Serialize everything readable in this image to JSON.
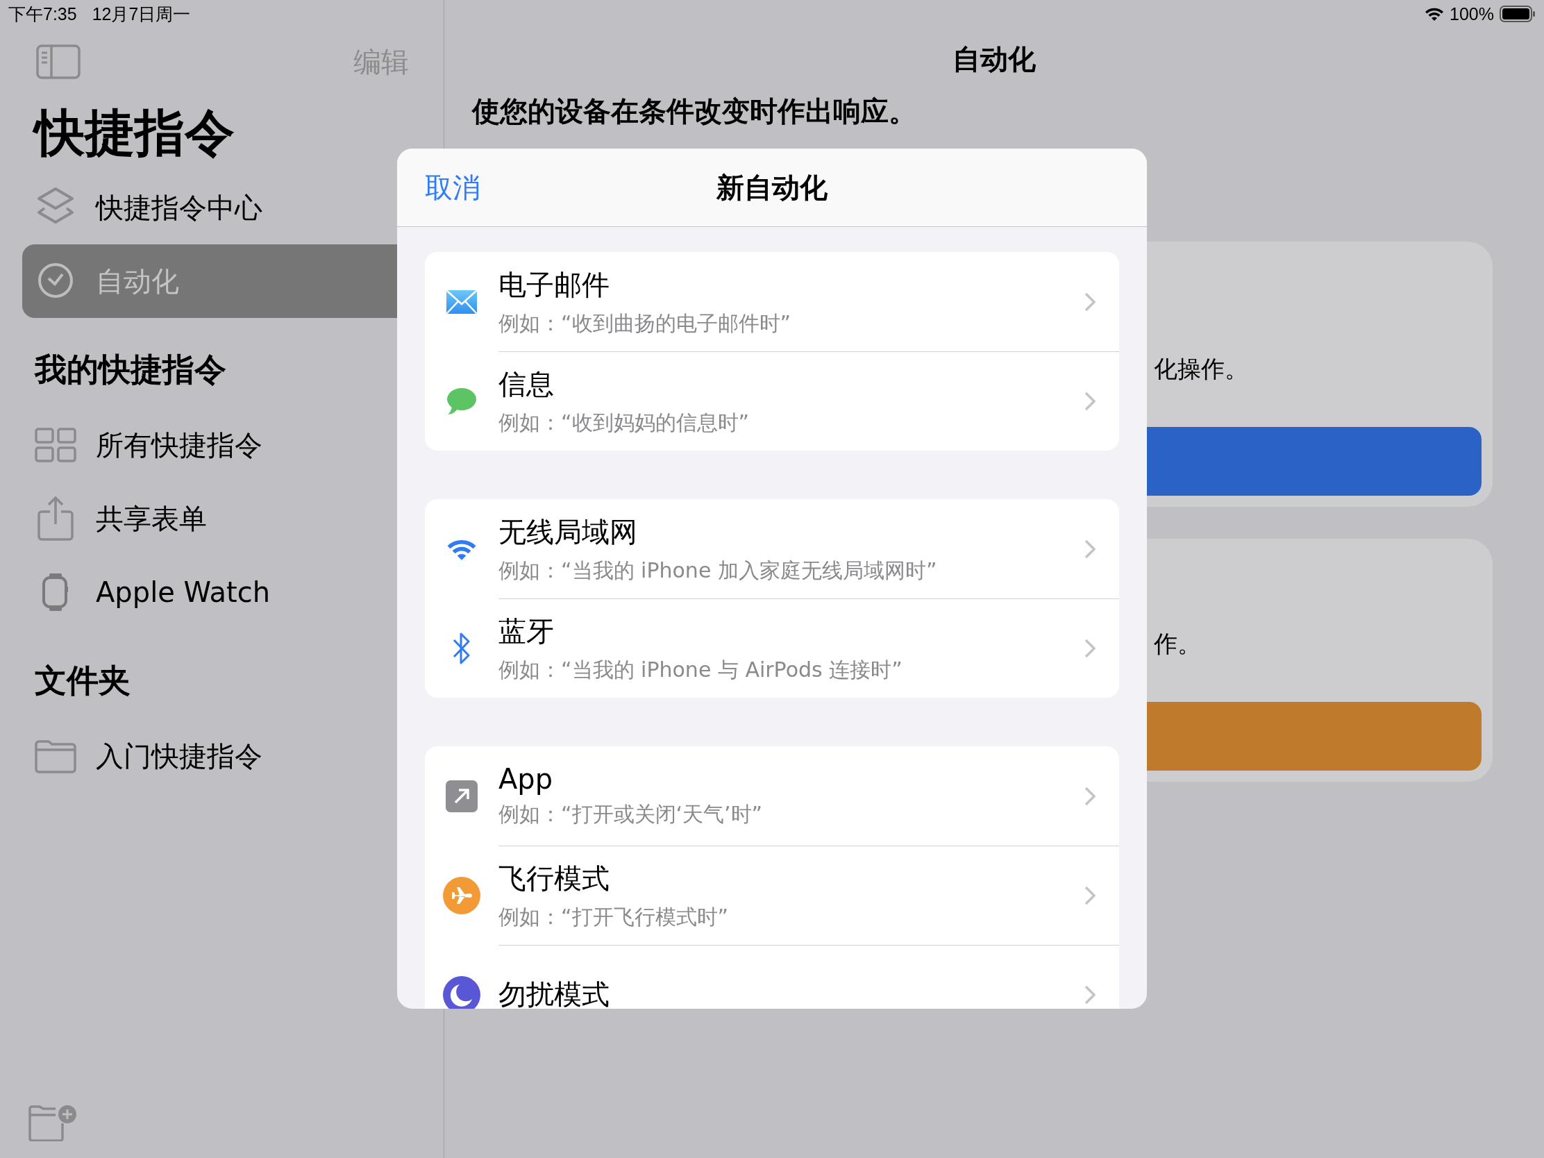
{
  "status_bar": {
    "time": "下午7:35",
    "date": "12月7日周一",
    "battery": "100%"
  },
  "sidebar": {
    "edit": "编辑",
    "title": "快捷指令",
    "items": [
      {
        "label": "快捷指令中心",
        "kind": "gallery",
        "selected": false
      },
      {
        "label": "自动化",
        "kind": "automation",
        "selected": true
      }
    ],
    "sections": [
      {
        "title": "我的快捷指令",
        "items": [
          {
            "label": "所有快捷指令",
            "kind": "grid"
          },
          {
            "label": "共享表单",
            "kind": "share"
          },
          {
            "label": "Apple Watch",
            "kind": "watch"
          }
        ]
      },
      {
        "title": "文件夹",
        "items": [
          {
            "label": "入门快捷指令",
            "kind": "folder"
          }
        ]
      }
    ]
  },
  "main": {
    "title": "自动化",
    "subtitle": "使您的设备在条件改变时作出响应。",
    "cards": [
      {
        "text": "化操作。",
        "color": "#2a62c6"
      },
      {
        "text": "作。",
        "color": "#c07a2c"
      }
    ]
  },
  "modal": {
    "cancel": "取消",
    "title": "新自动化",
    "groups": [
      {
        "rows": [
          {
            "kind": "mail",
            "title": "电子邮件",
            "example": "例如：“收到曲扬的电子邮件时”"
          },
          {
            "kind": "message",
            "title": "信息",
            "example": "例如：“收到妈妈的信息时”"
          }
        ]
      },
      {
        "rows": [
          {
            "kind": "wifi",
            "title": "无线局域网",
            "example": "例如：“当我的 iPhone 加入家庭无线局域网时”"
          },
          {
            "kind": "bluetooth",
            "title": "蓝牙",
            "example": "例如：“当我的 iPhone 与 AirPods 连接时”"
          }
        ]
      },
      {
        "rows": [
          {
            "kind": "app",
            "title": "App",
            "example": "例如：“打开或关闭‘天气’时”"
          },
          {
            "kind": "airplane",
            "title": "飞行模式",
            "example": "例如：“打开飞行模式时”"
          },
          {
            "kind": "moon",
            "title": "勿扰模式"
          }
        ]
      }
    ]
  }
}
